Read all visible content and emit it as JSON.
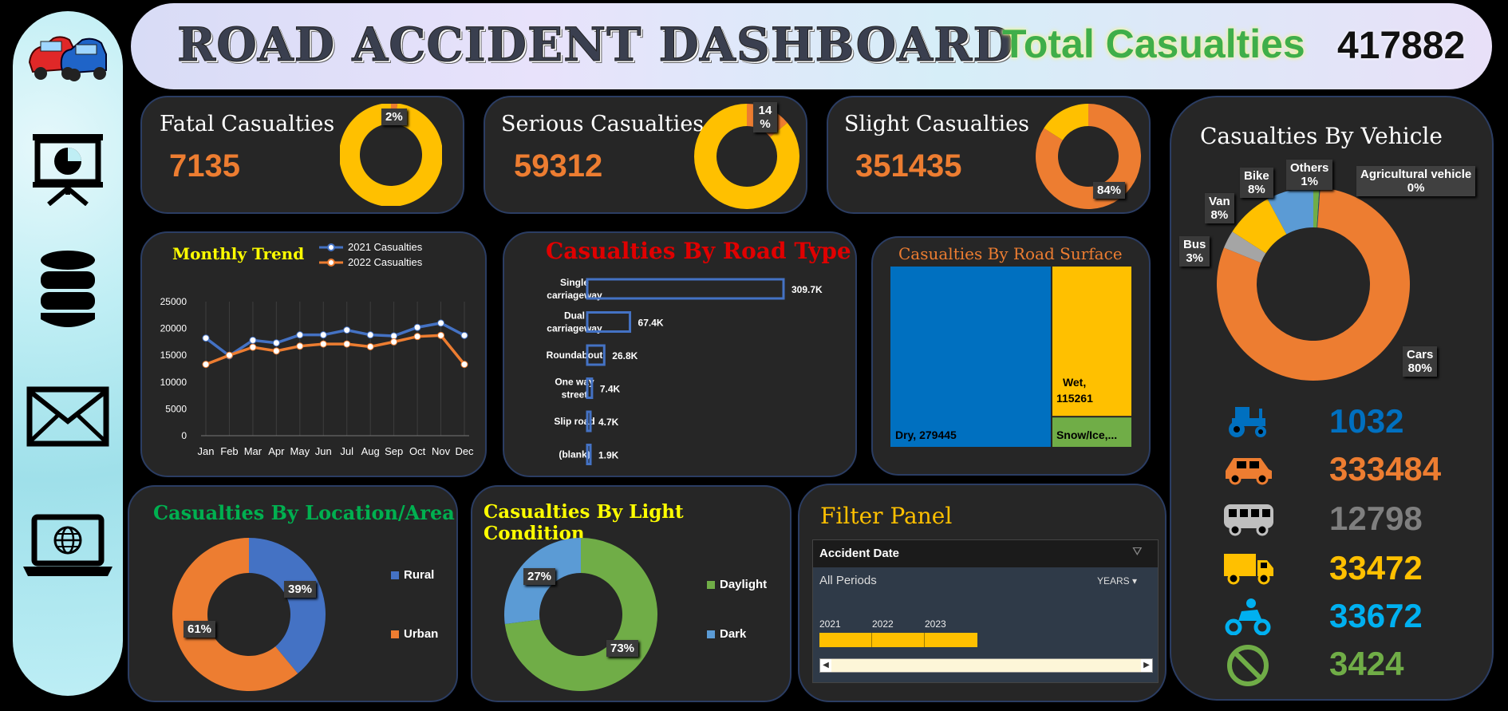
{
  "header": {
    "title": "ROAD ACCIDENT DASHBOARD",
    "total_label": "Total Casualties",
    "total_value": "417882"
  },
  "sidebar": {
    "icons": [
      "cars-logo-icon",
      "presentation-chart-icon",
      "database-icon",
      "mail-icon",
      "laptop-globe-icon"
    ]
  },
  "kpis": [
    {
      "label": "Fatal Casualties",
      "value": "7135",
      "pct_label": "2%",
      "pct": 0.02
    },
    {
      "label": "Serious Casualties",
      "value": "59312",
      "pct_label": "14\n%",
      "pct": 0.14
    },
    {
      "label": "Slight Casualties",
      "value": "351435",
      "pct_label": "84%",
      "pct": 0.84
    }
  ],
  "colors": {
    "orange": "#ed7d31",
    "yellow": "#ffc000",
    "blue": "#4472c4",
    "green": "#70ad47",
    "grey": "#a5a5a5",
    "lightblue": "#5b9bd5"
  },
  "monthly_trend": {
    "title": "Monthly Trend",
    "chart_data": {
      "type": "line",
      "categories": [
        "Jan",
        "Feb",
        "Mar",
        "Apr",
        "May",
        "Jun",
        "Jul",
        "Aug",
        "Sep",
        "Oct",
        "Nov",
        "Dec"
      ],
      "series": [
        {
          "name": "2021 Casualties",
          "values": [
            18200,
            14900,
            17800,
            17300,
            18800,
            18800,
            19700,
            18800,
            18600,
            20200,
            21000,
            18700
          ]
        },
        {
          "name": "2022 Casualties",
          "values": [
            13300,
            15000,
            16500,
            15800,
            16700,
            17100,
            17100,
            16600,
            17500,
            18500,
            18700,
            13300
          ]
        }
      ],
      "yticks": [
        "25000",
        "20000",
        "15000",
        "10000",
        "5000",
        "0"
      ],
      "ylim": [
        0,
        25000
      ]
    }
  },
  "road_type": {
    "title": "Casualties By Road Type",
    "chart_data": {
      "type": "bar",
      "categories": [
        "Single carriageway",
        "Dual carriageway",
        "Roundabout",
        "One way street",
        "Slip road",
        "(blank)"
      ],
      "values": [
        309700,
        67400,
        26800,
        7400,
        4700,
        1900
      ],
      "labels": [
        "309.7K",
        "67.4K",
        "26.8K",
        "7.4K",
        "4.7K",
        "1.9K"
      ]
    }
  },
  "road_surface": {
    "title": "Casualties By Road Surface",
    "chart_data": {
      "type": "treemap",
      "categories": [
        "Dry",
        "Wet",
        "Snow/Ice,..."
      ],
      "values": [
        279445,
        115261,
        23176
      ],
      "labels": [
        "Dry, 279445",
        "Wet, 115261",
        "Snow/Ice,..."
      ]
    }
  },
  "vehicle": {
    "title": "Casualties By Vehicle",
    "chart_data": {
      "type": "pie",
      "categories": [
        "Cars",
        "Bus",
        "Van",
        "Bike",
        "Others",
        "Agricultural vehicle"
      ],
      "values": [
        80,
        3,
        8,
        8,
        1,
        0
      ],
      "labels": [
        [
          "Cars",
          "80%"
        ],
        [
          "Bus",
          "3%"
        ],
        [
          "Van",
          "8%"
        ],
        [
          "Bike",
          "8%"
        ],
        [
          "Others",
          "1%"
        ],
        [
          "Agricultural vehicle",
          "0%"
        ]
      ]
    },
    "rows": [
      {
        "icon": "tractor-icon",
        "value": "1032",
        "color": "#0070c0"
      },
      {
        "icon": "car-icon",
        "value": "333484",
        "color": "#ed7d31"
      },
      {
        "icon": "bus-icon",
        "value": "12798",
        "color": "#7f7f7f"
      },
      {
        "icon": "truck-icon",
        "value": "33472",
        "color": "#ffc000"
      },
      {
        "icon": "bike-icon",
        "value": "33672",
        "color": "#00b0f0"
      },
      {
        "icon": "no-entry-icon",
        "value": "3424",
        "color": "#70ad47"
      }
    ]
  },
  "location": {
    "title": "Casualties By Location/Area",
    "chart_data": {
      "type": "pie",
      "categories": [
        "Rural",
        "Urban"
      ],
      "values": [
        39,
        61
      ],
      "labels": [
        "39%",
        "61%"
      ]
    }
  },
  "light": {
    "title": "Casualties By Light Condition",
    "chart_data": {
      "type": "pie",
      "categories": [
        "Daylight",
        "Dark"
      ],
      "values": [
        73,
        27
      ],
      "labels": [
        "73%",
        "27%"
      ]
    }
  },
  "filter": {
    "title": "Filter Panel",
    "field": "Accident Date",
    "period": "All Periods",
    "unit": "YEARS",
    "years": [
      "2021",
      "2022",
      "2023"
    ]
  }
}
